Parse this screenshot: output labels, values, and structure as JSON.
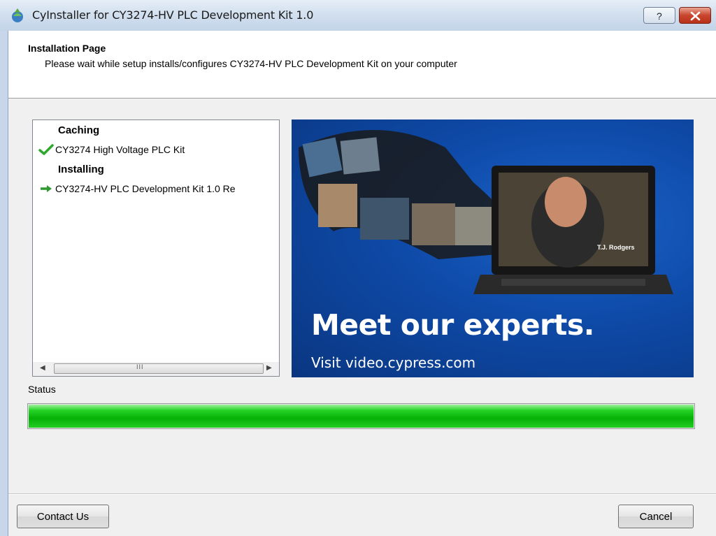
{
  "window": {
    "title": "CyInstaller for CY3274-HV PLC Development Kit 1.0",
    "help_glyph": "?",
    "close_glyph": "x"
  },
  "header": {
    "title": "Installation Page",
    "subtitle": "Please wait while setup installs/configures CY3274-HV PLC Development Kit on your computer"
  },
  "tree": {
    "groups": [
      {
        "label": "Caching",
        "items": [
          {
            "label": "CY3274 High Voltage PLC Kit",
            "state": "done",
            "icon": "check-icon"
          }
        ]
      },
      {
        "label": "Installing",
        "items": [
          {
            "label": "CY3274-HV PLC Development Kit 1.0 Re",
            "state": "in-progress",
            "icon": "arrow-right-icon"
          }
        ]
      }
    ],
    "scroll_grip": "III"
  },
  "banner": {
    "headline": "Meet our experts.",
    "link_text": "Visit video.cypress.com",
    "caption": "T.J. Rodgers"
  },
  "status": {
    "label": "Status",
    "progress": 1.0
  },
  "buttons": {
    "contact": "Contact Us",
    "cancel": "Cancel"
  },
  "colors": {
    "progress_green": "#06b006",
    "banner_blue": "#0e4aa8",
    "check_green": "#2da82d"
  }
}
